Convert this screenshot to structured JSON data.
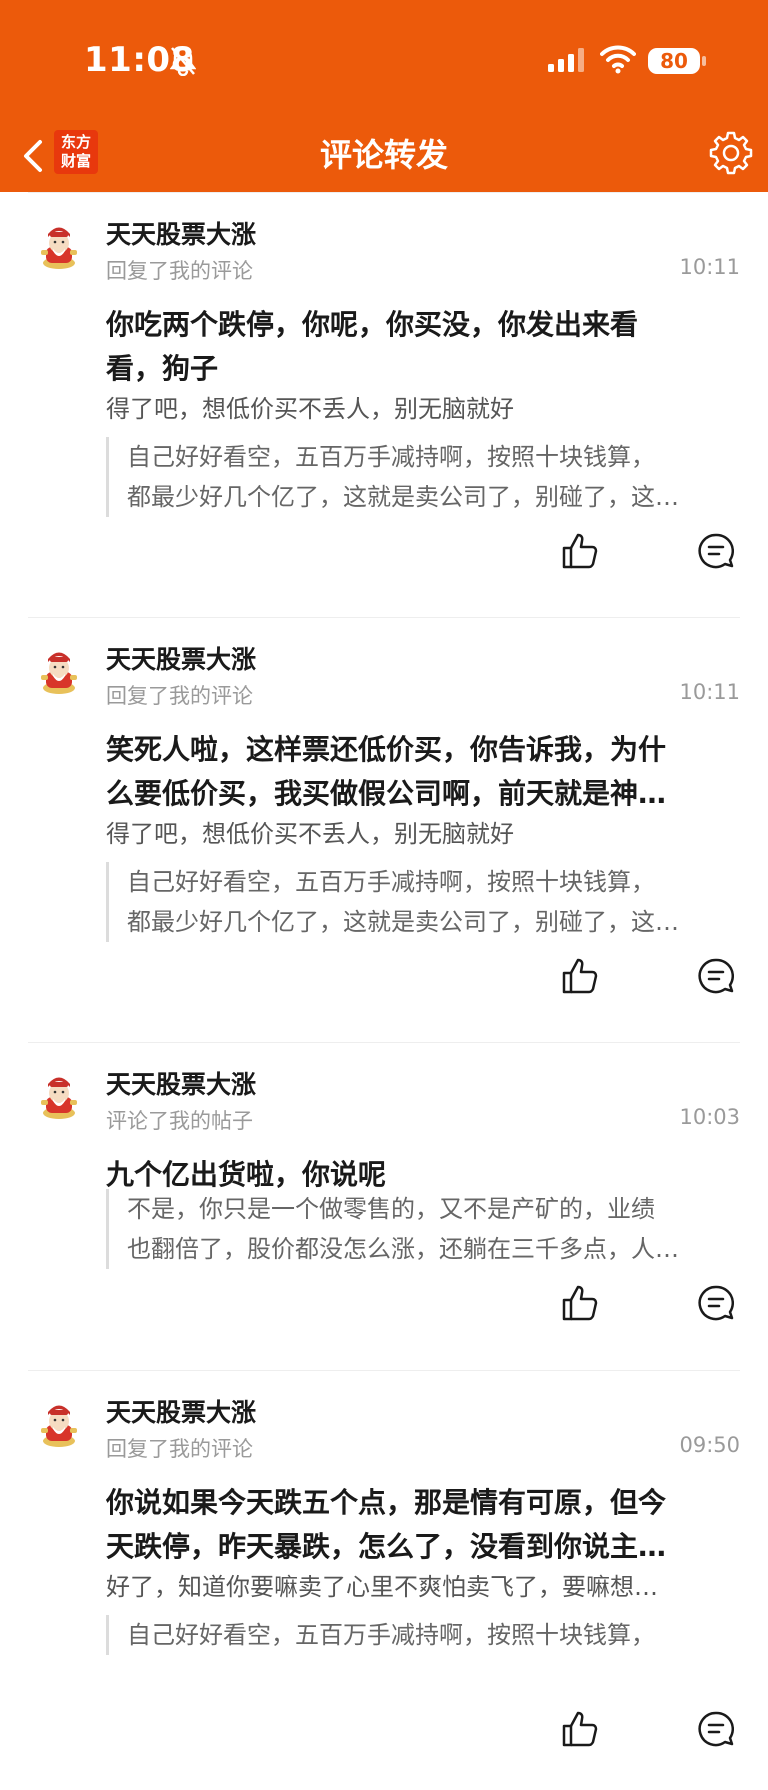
{
  "status": {
    "time": "11:08",
    "battery": "80"
  },
  "nav": {
    "logo_line1": "东方",
    "logo_line2": "财富",
    "title": "评论转发"
  },
  "colors": {
    "brand": "#ec5a0b",
    "text": "#1a1a1a",
    "muted": "#9a9a9a"
  },
  "items": [
    {
      "user": "天天股票大涨",
      "action": "回复了我的评论",
      "time": "10:11",
      "content_line1": "你吃两个跌停，你呢，你买没，你发出来看",
      "content_line2": "看，狗子",
      "reply": "得了吧，想低价买不丢人，别无脑就好",
      "quote_line1": "自己好好看空，五百万手减持啊，按照十块钱算，",
      "quote_line2": "都最少好几个亿了，这就是卖公司了，别碰了，这…"
    },
    {
      "user": "天天股票大涨",
      "action": "回复了我的评论",
      "time": "10:11",
      "content_line1": "笑死人啦，这样票还低价买，你告诉我，为什",
      "content_line2": "么要低价买，我买做假公司啊，前天就是神…",
      "reply": "得了吧，想低价买不丢人，别无脑就好",
      "quote_line1": "自己好好看空，五百万手减持啊，按照十块钱算，",
      "quote_line2": "都最少好几个亿了，这就是卖公司了，别碰了，这…"
    },
    {
      "user": "天天股票大涨",
      "action": "评论了我的帖子",
      "time": "10:03",
      "content_line1": "九个亿出货啦，你说呢",
      "content_line2": "",
      "reply": "",
      "quote_line1": "不是，你只是一个做零售的，又不是产矿的，业绩",
      "quote_line2": "也翻倍了，股价都没怎么涨，还躺在三千多点，人…"
    },
    {
      "user": "天天股票大涨",
      "action": "回复了我的评论",
      "time": "09:50",
      "content_line1": "你说如果今天跌五个点，那是情有可原，但今",
      "content_line2": "天跌停，昨天暴跌，怎么了，没看到你说主…",
      "reply": "好了，知道你要嘛卖了心里不爽怕卖飞了，要嘛想…",
      "quote_line1": "自己好好看空，五百万手减持啊，按照十块钱算，",
      "quote_line2": ""
    }
  ]
}
